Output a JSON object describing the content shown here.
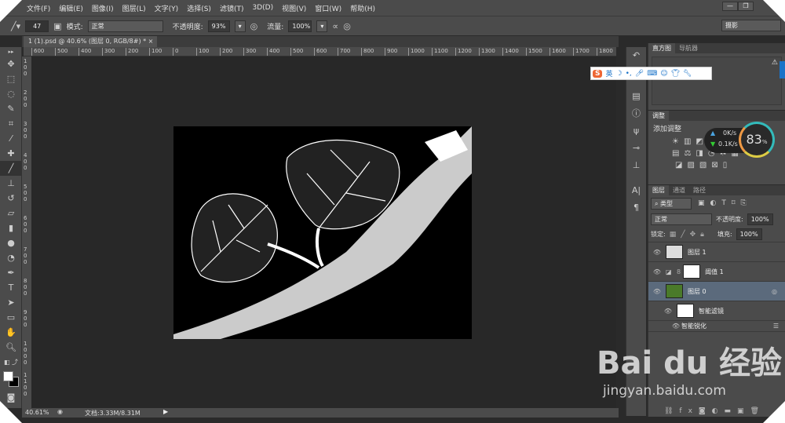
{
  "menu": [
    "文件(F)",
    "编辑(E)",
    "图像(I)",
    "图层(L)",
    "文字(Y)",
    "选择(S)",
    "滤镜(T)",
    "3D(D)",
    "视图(V)",
    "窗口(W)",
    "帮助(H)"
  ],
  "window_buttons": [
    "—",
    "❐"
  ],
  "options": {
    "brush_size": "47",
    "mode_label": "模式:",
    "mode_value": "正常",
    "opacity_label": "不透明度:",
    "opacity_value": "93%",
    "flow_label": "流量:",
    "flow_value": "100%",
    "workspace": "摄影"
  },
  "doc_tab": {
    "title": "1 (1).psd @ 40.6% (图层 0, RGB/8#) *",
    "close": "×"
  },
  "ruler_h": [
    "600",
    "500",
    "400",
    "300",
    "200",
    "100",
    "0",
    "100",
    "200",
    "300",
    "400",
    "500",
    "600",
    "700",
    "800",
    "900",
    "1000",
    "1100",
    "1200",
    "1300",
    "1400",
    "1500",
    "1600",
    "1700",
    "1800"
  ],
  "ruler_v": [
    "100",
    "200",
    "300",
    "400",
    "500",
    "600",
    "700",
    "800",
    "900",
    "1000",
    "1100"
  ],
  "status": {
    "zoom": "40.61%",
    "doc_size": "文档:3.33M/8.31M"
  },
  "ime": {
    "logo": "S",
    "lang": "英"
  },
  "panels": {
    "histogram_tabs": [
      "直方图",
      "导航器"
    ],
    "adjust_tab": "调整",
    "adjust_title": "添加调整",
    "layers_tabs": [
      "图层",
      "通道",
      "路径"
    ],
    "filter_kind": "类型",
    "blend_mode": "正常",
    "opacity_label": "不透明度:",
    "opacity_value": "100%",
    "lock_label": "锁定:",
    "fill_label": "填充:",
    "fill_value": "100%",
    "layers": [
      {
        "name": "图层 1"
      },
      {
        "name": "阈值 1"
      },
      {
        "name": "图层 0",
        "selected": true
      }
    ],
    "smart_filter": "智能滤镜",
    "smart_sharpen": "智能锐化"
  },
  "network": {
    "up": "0K/s",
    "down": "0.1K/s",
    "percent": "83",
    "unit": "%"
  },
  "watermark": {
    "brand": "Bai du 经验",
    "url": "jingyan.baidu.com"
  }
}
